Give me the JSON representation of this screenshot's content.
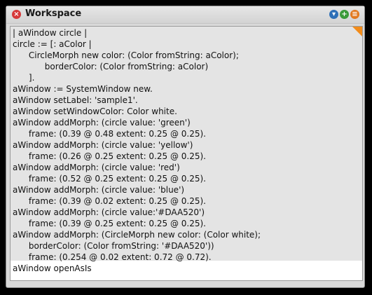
{
  "window": {
    "title": "Workspace",
    "close_glyph": "×",
    "collapse_glyph": "▾",
    "expand_glyph": "+",
    "menu_glyph": "≡"
  },
  "colors": {
    "close": "#d6393a",
    "collapse": "#2e6fb7",
    "expand": "#3a9a3a",
    "menu": "#e27a20",
    "selection": "#e4e4e4"
  },
  "editor": {
    "lines": [
      "| aWindow circle |",
      "circle := [: aColor |",
      "      CircleMorph new color: (Color fromString: aColor);",
      "            borderColor: (Color fromString: aColor)",
      "      ].",
      "aWindow := SystemWindow new.",
      "aWindow setLabel: 'sample1'.",
      "aWindow setWindowColor: Color white.",
      "aWindow addMorph: (circle value: 'green')",
      "      frame: (0.39 @ 0.48 extent: 0.25 @ 0.25).",
      "aWindow addMorph: (circle value: 'yellow')",
      "      frame: (0.26 @ 0.25 extent: 0.25 @ 0.25).",
      "aWindow addMorph: (circle value: 'red')",
      "      frame: (0.52 @ 0.25 extent: 0.25 @ 0.25).",
      "aWindow addMorph: (circle value: 'blue')",
      "      frame: (0.39 @ 0.02 extent: 0.25 @ 0.25).",
      "aWindow addMorph: (circle value:'#DAA520')",
      "      frame: (0.39 @ 0.25 extent: 0.25 @ 0.25).",
      "aWindow addMorph: (CircleMorph new color: (Color white);",
      "      borderColor: (Color fromString: '#DAA520'))",
      "      frame: (0.254 @ 0.02 extent: 0.72 @ 0.72).",
      "aWindow openAsIs"
    ]
  }
}
